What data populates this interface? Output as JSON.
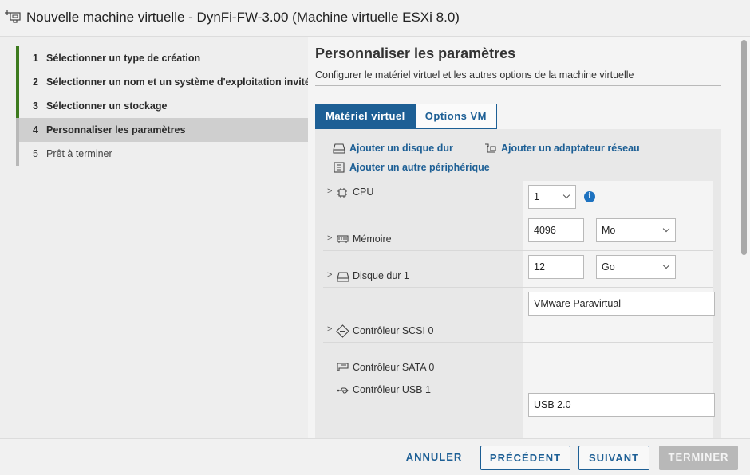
{
  "window": {
    "title": "Nouvelle machine virtuelle - DynFi-FW-3.00 (Machine virtuelle ESXi 8.0)",
    "icon": "new-vm-icon"
  },
  "wizard": {
    "steps": [
      {
        "num": "1",
        "label": "Sélectionner un type de création",
        "state": "done"
      },
      {
        "num": "2",
        "label": "Sélectionner un nom et un système d'exploitation invité",
        "state": "done"
      },
      {
        "num": "3",
        "label": "Sélectionner un stockage",
        "state": "done"
      },
      {
        "num": "4",
        "label": "Personnaliser les paramètres",
        "state": "current"
      },
      {
        "num": "5",
        "label": "Prêt à terminer",
        "state": "pending"
      }
    ]
  },
  "main": {
    "title": "Personnaliser les paramètres",
    "subtitle": "Configurer le matériel virtuel et les autres options de la machine virtuelle",
    "tabs": [
      {
        "label": "Matériel virtuel",
        "active": true
      },
      {
        "label": "Options VM",
        "active": false
      }
    ],
    "actions": {
      "add_disk": "Ajouter un disque dur",
      "add_network": "Ajouter un adaptateur réseau",
      "add_other": "Ajouter un autre périphérique"
    },
    "hardware": {
      "cpu": {
        "label": "CPU",
        "value": "1",
        "icon": "cpu-icon"
      },
      "memory": {
        "label": "Mémoire",
        "value": "4096",
        "unit": "Mo",
        "icon": "memory-icon"
      },
      "disk": {
        "label": "Disque dur 1",
        "value": "12",
        "unit": "Go",
        "icon": "hard-disk-icon"
      },
      "scsi": {
        "label": "Contrôleur SCSI 0",
        "value": "VMware Paravirtual",
        "icon": "scsi-controller-icon"
      },
      "sata": {
        "label": "Contrôleur SATA 0",
        "icon": "sata-controller-icon"
      },
      "usb": {
        "label": "Contrôleur USB 1",
        "value": "USB 2.0",
        "icon": "usb-icon"
      }
    }
  },
  "footer": {
    "cancel": "ANNULER",
    "previous": "PRÉCÉDENT",
    "next": "SUIVANT",
    "finish": "TERMINER"
  },
  "colors": {
    "accent": "#1d5f95",
    "step_done": "#3d7a1e",
    "disabled": "#b8b8b8",
    "info": "#1d72c0"
  }
}
